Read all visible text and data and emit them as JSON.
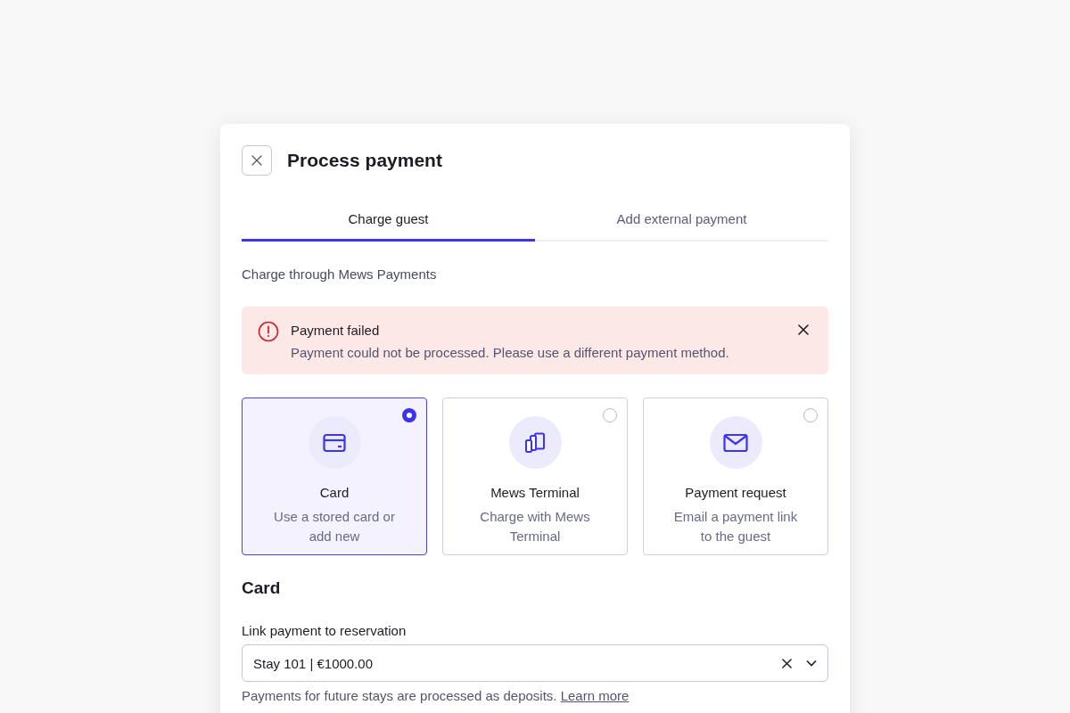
{
  "dialog": {
    "title": "Process payment"
  },
  "tabs": [
    {
      "label": "Charge guest",
      "selected": true
    },
    {
      "label": "Add external payment",
      "selected": false
    }
  ],
  "subtitle": "Charge through Mews Payments",
  "alert": {
    "title": "Payment failed",
    "message": "Payment could not be processed. Please use a different payment method."
  },
  "options": [
    {
      "title": "Card",
      "description": "Use a stored card or add new",
      "selected": true
    },
    {
      "title": "Mews Terminal",
      "description": "Charge with Mews Terminal",
      "selected": false
    },
    {
      "title": "Payment request",
      "description": "Email a payment link to the guest",
      "selected": false
    }
  ],
  "section_title": "Card",
  "reservation": {
    "label": "Link payment to reservation",
    "value": "Stay 101 | €1000.00",
    "helper": "Payments for future stays are processed as deposits.",
    "link": "Learn more"
  }
}
